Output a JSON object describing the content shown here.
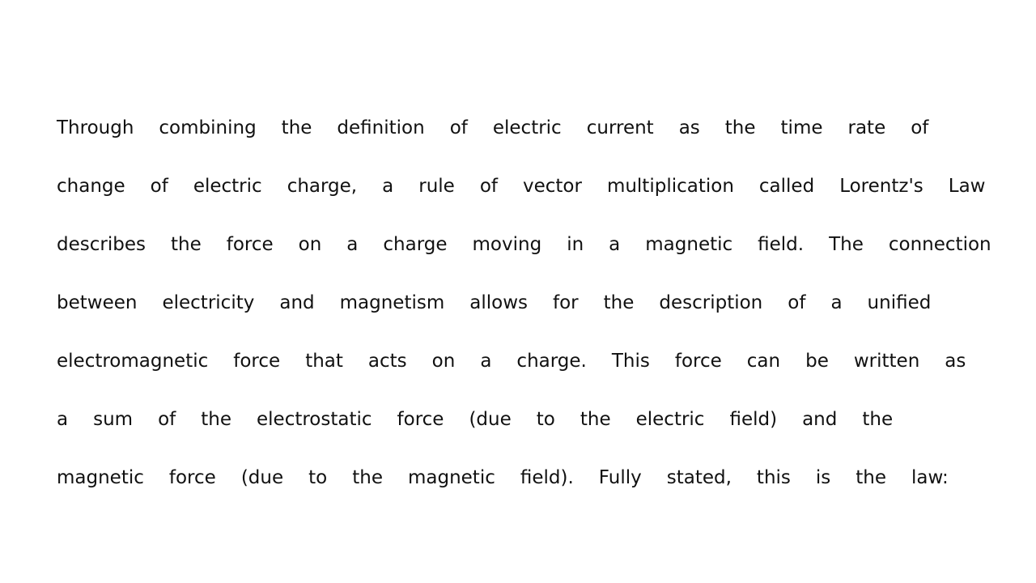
{
  "document": {
    "lines": [
      [
        "Through",
        "combining",
        "the",
        "definition",
        "of",
        "electric",
        "current",
        "as",
        "the",
        "time",
        "rate",
        "of"
      ],
      [
        "change",
        "of",
        "electric",
        "charge,",
        "a",
        "rule",
        "of",
        "vector",
        "multiplication",
        "called",
        "Lorentz's",
        "Law"
      ],
      [
        "describes",
        "the",
        "force",
        "on",
        "a",
        "charge",
        "moving",
        "in",
        "a",
        "magnetic",
        "field.",
        "The",
        "connection"
      ],
      [
        "between",
        "electricity",
        "and",
        "magnetism",
        "allows",
        "for",
        "the",
        "description",
        "of",
        "a",
        "unified"
      ],
      [
        "electromagnetic",
        "force",
        "that",
        "acts",
        "on",
        "a",
        "charge.",
        "This",
        "force",
        "can",
        "be",
        "written",
        "as"
      ],
      [
        "a",
        "sum",
        "of",
        "the",
        "electrostatic",
        "force",
        "(due",
        "to",
        "the",
        "electric",
        "field)",
        "and",
        "the"
      ],
      [
        "magnetic",
        "force",
        "(due",
        "to",
        "the",
        "magnetic",
        "field).",
        "Fully",
        "stated,",
        "this",
        "is",
        "the",
        "law:"
      ]
    ]
  }
}
